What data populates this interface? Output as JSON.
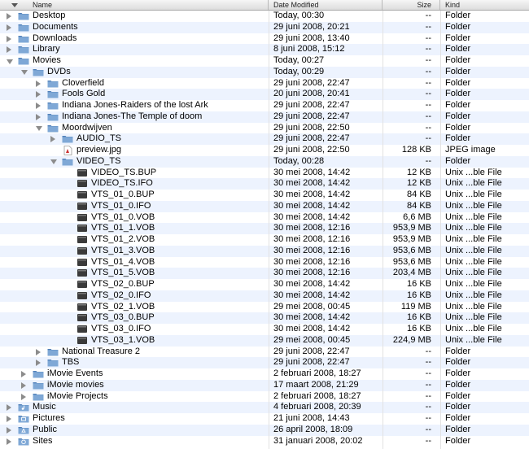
{
  "header": {
    "name": "Name",
    "date": "Date Modified",
    "size": "Size",
    "kind": "Kind"
  },
  "rows": [
    {
      "name": "Desktop",
      "date": "Today, 00:30",
      "size": "--",
      "kind": "Folder",
      "depth": 0,
      "icon": "folder-icon",
      "disclosure": "closed"
    },
    {
      "name": "Documents",
      "date": "29 juni 2008, 20:21",
      "size": "--",
      "kind": "Folder",
      "depth": 0,
      "icon": "folder-icon",
      "disclosure": "closed"
    },
    {
      "name": "Downloads",
      "date": "29 juni 2008, 13:40",
      "size": "--",
      "kind": "Folder",
      "depth": 0,
      "icon": "folder-icon",
      "disclosure": "closed"
    },
    {
      "name": "Library",
      "date": "8 juni 2008, 15:12",
      "size": "--",
      "kind": "Folder",
      "depth": 0,
      "icon": "folder-icon",
      "disclosure": "closed"
    },
    {
      "name": "Movies",
      "date": "Today, 00:27",
      "size": "--",
      "kind": "Folder",
      "depth": 0,
      "icon": "folder-icon",
      "disclosure": "open"
    },
    {
      "name": "DVDs",
      "date": "Today, 00:29",
      "size": "--",
      "kind": "Folder",
      "depth": 1,
      "icon": "folder-icon",
      "disclosure": "open"
    },
    {
      "name": "Cloverfield",
      "date": "29 juni 2008, 22:47",
      "size": "--",
      "kind": "Folder",
      "depth": 2,
      "icon": "folder-icon",
      "disclosure": "closed"
    },
    {
      "name": "Fools Gold",
      "date": "20 juni 2008, 20:41",
      "size": "--",
      "kind": "Folder",
      "depth": 2,
      "icon": "folder-icon",
      "disclosure": "closed"
    },
    {
      "name": "Indiana Jones-Raiders of the lost Ark",
      "date": "29 juni 2008, 22:47",
      "size": "--",
      "kind": "Folder",
      "depth": 2,
      "icon": "folder-icon",
      "disclosure": "closed"
    },
    {
      "name": "Indiana Jones-The Temple  of doom",
      "date": "29 juni 2008, 22:47",
      "size": "--",
      "kind": "Folder",
      "depth": 2,
      "icon": "folder-icon",
      "disclosure": "closed"
    },
    {
      "name": "Moordwijven",
      "date": "29 juni 2008, 22:50",
      "size": "--",
      "kind": "Folder",
      "depth": 2,
      "icon": "folder-icon",
      "disclosure": "open"
    },
    {
      "name": "AUDIO_TS",
      "date": "29 juni 2008, 22:47",
      "size": "--",
      "kind": "Folder",
      "depth": 3,
      "icon": "folder-icon",
      "disclosure": "closed"
    },
    {
      "name": "preview.jpg",
      "date": "29 juni 2008, 22:50",
      "size": "128 KB",
      "kind": "JPEG image",
      "depth": 3,
      "icon": "jpeg-file-icon",
      "disclosure": "none"
    },
    {
      "name": "VIDEO_TS",
      "date": "Today, 00:28",
      "size": "--",
      "kind": "Folder",
      "depth": 3,
      "icon": "folder-icon",
      "disclosure": "open"
    },
    {
      "name": "VIDEO_TS.BUP",
      "date": "30 mei 2008, 14:42",
      "size": "12 KB",
      "kind": "Unix ...ble File",
      "depth": 4,
      "icon": "unix-executable-icon",
      "disclosure": "none"
    },
    {
      "name": "VIDEO_TS.IFO",
      "date": "30 mei 2008, 14:42",
      "size": "12 KB",
      "kind": "Unix ...ble File",
      "depth": 4,
      "icon": "unix-executable-icon",
      "disclosure": "none"
    },
    {
      "name": "VTS_01_0.BUP",
      "date": "30 mei 2008, 14:42",
      "size": "84 KB",
      "kind": "Unix ...ble File",
      "depth": 4,
      "icon": "unix-executable-icon",
      "disclosure": "none"
    },
    {
      "name": "VTS_01_0.IFO",
      "date": "30 mei 2008, 14:42",
      "size": "84 KB",
      "kind": "Unix ...ble File",
      "depth": 4,
      "icon": "unix-executable-icon",
      "disclosure": "none"
    },
    {
      "name": "VTS_01_0.VOB",
      "date": "30 mei 2008, 14:42",
      "size": "6,6 MB",
      "kind": "Unix ...ble File",
      "depth": 4,
      "icon": "unix-executable-icon",
      "disclosure": "none"
    },
    {
      "name": "VTS_01_1.VOB",
      "date": "30 mei 2008, 12:16",
      "size": "953,9 MB",
      "kind": "Unix ...ble File",
      "depth": 4,
      "icon": "unix-executable-icon",
      "disclosure": "none"
    },
    {
      "name": "VTS_01_2.VOB",
      "date": "30 mei 2008, 12:16",
      "size": "953,9 MB",
      "kind": "Unix ...ble File",
      "depth": 4,
      "icon": "unix-executable-icon",
      "disclosure": "none"
    },
    {
      "name": "VTS_01_3.VOB",
      "date": "30 mei 2008, 12:16",
      "size": "953,6 MB",
      "kind": "Unix ...ble File",
      "depth": 4,
      "icon": "unix-executable-icon",
      "disclosure": "none"
    },
    {
      "name": "VTS_01_4.VOB",
      "date": "30 mei 2008, 12:16",
      "size": "953,6 MB",
      "kind": "Unix ...ble File",
      "depth": 4,
      "icon": "unix-executable-icon",
      "disclosure": "none"
    },
    {
      "name": "VTS_01_5.VOB",
      "date": "30 mei 2008, 12:16",
      "size": "203,4 MB",
      "kind": "Unix ...ble File",
      "depth": 4,
      "icon": "unix-executable-icon",
      "disclosure": "none"
    },
    {
      "name": "VTS_02_0.BUP",
      "date": "30 mei 2008, 14:42",
      "size": "16 KB",
      "kind": "Unix ...ble File",
      "depth": 4,
      "icon": "unix-executable-icon",
      "disclosure": "none"
    },
    {
      "name": "VTS_02_0.IFO",
      "date": "30 mei 2008, 14:42",
      "size": "16 KB",
      "kind": "Unix ...ble File",
      "depth": 4,
      "icon": "unix-executable-icon",
      "disclosure": "none"
    },
    {
      "name": "VTS_02_1.VOB",
      "date": "29 mei 2008, 00:45",
      "size": "119 MB",
      "kind": "Unix ...ble File",
      "depth": 4,
      "icon": "unix-executable-icon",
      "disclosure": "none"
    },
    {
      "name": "VTS_03_0.BUP",
      "date": "30 mei 2008, 14:42",
      "size": "16 KB",
      "kind": "Unix ...ble File",
      "depth": 4,
      "icon": "unix-executable-icon",
      "disclosure": "none"
    },
    {
      "name": "VTS_03_0.IFO",
      "date": "30 mei 2008, 14:42",
      "size": "16 KB",
      "kind": "Unix ...ble File",
      "depth": 4,
      "icon": "unix-executable-icon",
      "disclosure": "none"
    },
    {
      "name": "VTS_03_1.VOB",
      "date": "29 mei 2008, 00:45",
      "size": "224,9 MB",
      "kind": "Unix ...ble File",
      "depth": 4,
      "icon": "unix-executable-icon",
      "disclosure": "none"
    },
    {
      "name": "National Treasure 2",
      "date": "29 juni 2008, 22:47",
      "size": "--",
      "kind": "Folder",
      "depth": 2,
      "icon": "folder-icon",
      "disclosure": "closed"
    },
    {
      "name": "TBS",
      "date": "29 juni 2008, 22:47",
      "size": "--",
      "kind": "Folder",
      "depth": 2,
      "icon": "folder-icon",
      "disclosure": "closed"
    },
    {
      "name": "iMovie Events",
      "date": "2 februari 2008, 18:27",
      "size": "--",
      "kind": "Folder",
      "depth": 1,
      "icon": "folder-icon",
      "disclosure": "closed"
    },
    {
      "name": "iMovie movies",
      "date": "17 maart 2008, 21:29",
      "size": "--",
      "kind": "Folder",
      "depth": 1,
      "icon": "folder-icon",
      "disclosure": "closed"
    },
    {
      "name": "iMovie Projects",
      "date": "2 februari 2008, 18:27",
      "size": "--",
      "kind": "Folder",
      "depth": 1,
      "icon": "folder-icon",
      "disclosure": "closed"
    },
    {
      "name": "Music",
      "date": "4 februari 2008, 20:39",
      "size": "--",
      "kind": "Folder",
      "depth": 0,
      "icon": "music-folder-icon",
      "disclosure": "closed"
    },
    {
      "name": "Pictures",
      "date": "21 juni 2008, 14:43",
      "size": "--",
      "kind": "Folder",
      "depth": 0,
      "icon": "pictures-folder-icon",
      "disclosure": "closed"
    },
    {
      "name": "Public",
      "date": "26 april 2008, 18:09",
      "size": "--",
      "kind": "Folder",
      "depth": 0,
      "icon": "public-folder-icon",
      "disclosure": "closed"
    },
    {
      "name": "Sites",
      "date": "31 januari 2008, 20:02",
      "size": "--",
      "kind": "Folder",
      "depth": 0,
      "icon": "sites-folder-icon",
      "disclosure": "closed"
    }
  ],
  "colors": {
    "alt_row": "#edf3fe",
    "folder": "#7fa8d6",
    "folder_dark": "#4f7fb8",
    "file_dark": "#3a3a3a"
  }
}
